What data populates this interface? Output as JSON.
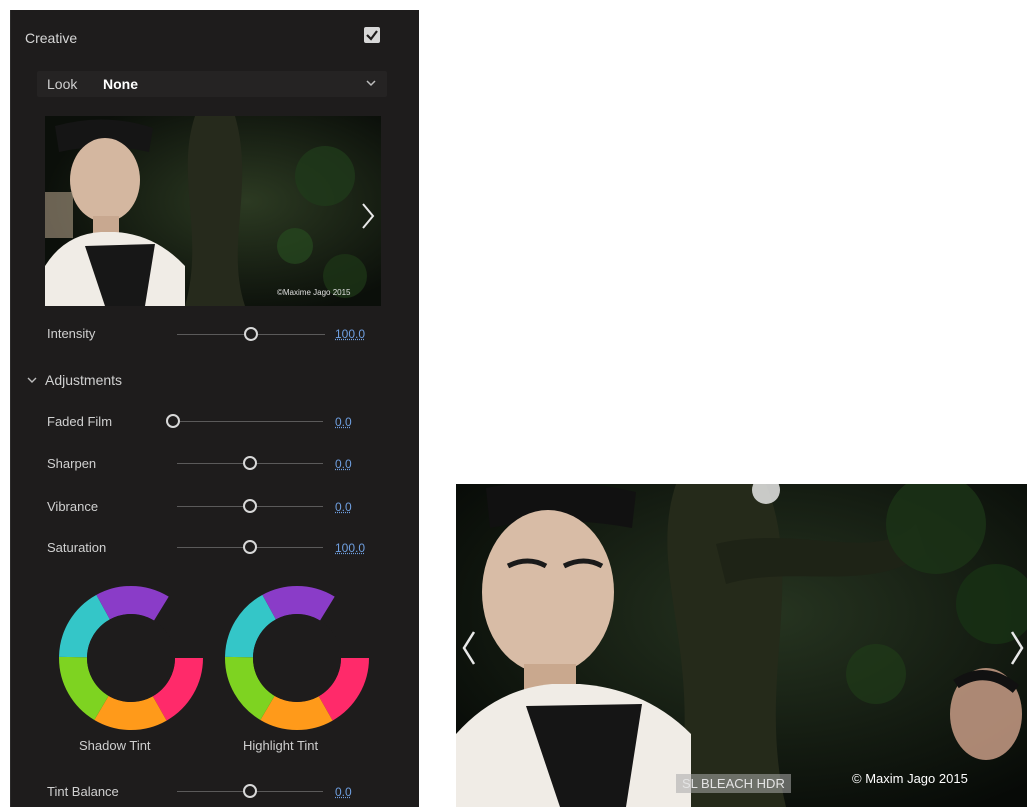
{
  "panel": {
    "title": "Creative",
    "enabled": true,
    "look_label": "Look",
    "look_value": "None",
    "thumbnail_watermark": "©Maxime Jago 2015",
    "intensity": {
      "label": "Intensity",
      "value": "100.0",
      "fraction": 0.5
    },
    "adjustments_title": "Adjustments",
    "sliders": [
      {
        "label": "Faded Film",
        "value": "0.0",
        "fraction": 0.0
      },
      {
        "label": "Sharpen",
        "value": "0.0",
        "fraction": 0.5
      },
      {
        "label": "Vibrance",
        "value": "0.0",
        "fraction": 0.5
      },
      {
        "label": "Saturation",
        "value": "100.0",
        "fraction": 0.5
      }
    ],
    "wheels": [
      {
        "label": "Shadow Tint"
      },
      {
        "label": "Highlight Tint"
      }
    ],
    "tint_balance": {
      "label": "Tint Balance",
      "value": "0.0",
      "fraction": 0.5
    }
  },
  "preview": {
    "look_name": "SL BLEACH HDR",
    "copyright": "© Maxim Jago 2015"
  },
  "colors": {
    "panel_bg": "#1e1c1c",
    "value_blue": "#6f9fe0"
  }
}
